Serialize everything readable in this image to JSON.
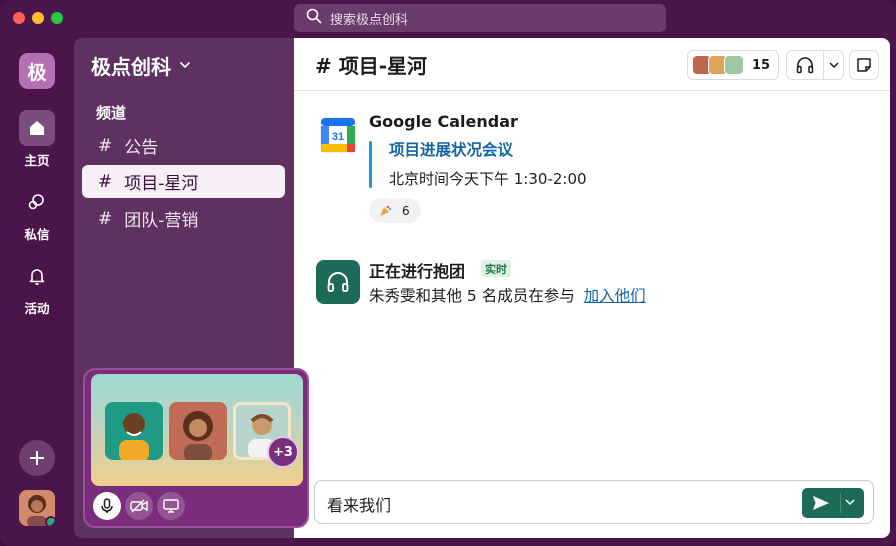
{
  "search": {
    "placeholder": "搜索极点创科"
  },
  "workspace": {
    "initial": "极",
    "name": "极点创科"
  },
  "rail": [
    {
      "label": "主页",
      "icon": "home-icon",
      "active": true
    },
    {
      "label": "私信",
      "icon": "dm-icon",
      "active": false
    },
    {
      "label": "活动",
      "icon": "bell-icon",
      "active": false
    }
  ],
  "sidebar": {
    "section_label": "频道",
    "channels": [
      {
        "hash": "#",
        "name": "公告",
        "active": false
      },
      {
        "hash": "#",
        "name": "项目-星河",
        "active": true
      },
      {
        "hash": "#",
        "name": "团队-营销",
        "active": false
      }
    ]
  },
  "huddle_card": {
    "extra_count": "+3"
  },
  "channel": {
    "title": "# 项目-星河",
    "member_count": "15"
  },
  "messages": {
    "calendar": {
      "sender": "Google Calendar",
      "calendar_day": "31",
      "event_title": "项目进展状况会议",
      "event_time": "北京时间今天下午 1:30-2:00",
      "reaction_count": "6"
    },
    "huddle": {
      "title": "正在进行抱团",
      "badge": "实时",
      "text": "朱秀雯和其他 5 名成员在参与",
      "join_link": "加入他们"
    }
  },
  "composer": {
    "value": "看来我们"
  },
  "colors": {
    "aubergine": "#4a154b",
    "sidebar": "#5e3160",
    "link": "#1264a3",
    "send_green": "#1e6a58"
  }
}
